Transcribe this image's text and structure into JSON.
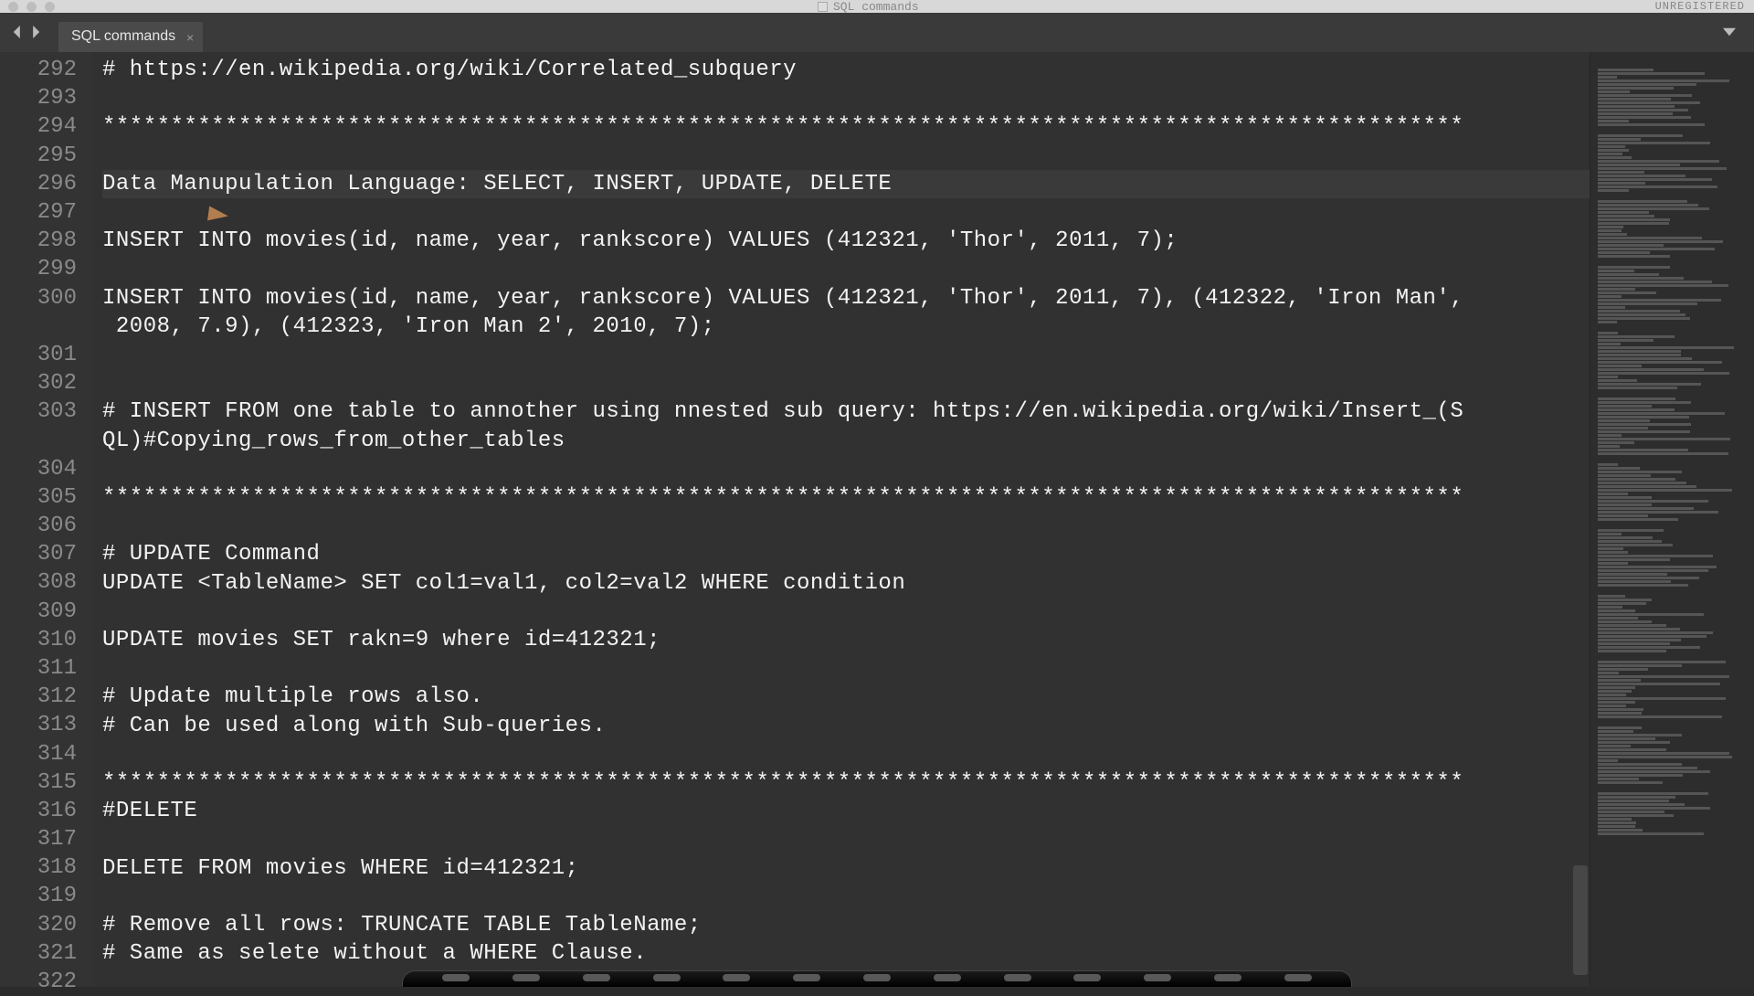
{
  "window": {
    "title_hint": "SQL commands",
    "unregistered_label": "UNREGISTERED"
  },
  "tabs": {
    "active": {
      "label": "SQL commands"
    }
  },
  "editor": {
    "first_line_number": 292,
    "highlighted_line_number": 296,
    "lines": [
      {
        "n": 292,
        "text": "# https://en.wikipedia.org/wiki/Correlated_subquery"
      },
      {
        "n": 293,
        "text": ""
      },
      {
        "n": 294,
        "text": "****************************************************************************************************"
      },
      {
        "n": 295,
        "text": ""
      },
      {
        "n": 296,
        "text": "Data Manupulation Language: SELECT, INSERT, UPDATE, DELETE"
      },
      {
        "n": 297,
        "text": ""
      },
      {
        "n": 298,
        "text": "INSERT INTO movies(id, name, year, rankscore) VALUES (412321, 'Thor', 2011, 7);"
      },
      {
        "n": 299,
        "text": ""
      },
      {
        "n": 300,
        "text": "INSERT INTO movies(id, name, year, rankscore) VALUES (412321, 'Thor', 2011, 7), (412322, 'Iron Man', 2008, 7.9), (412323, 'Iron Man 2', 2010, 7);"
      },
      {
        "n": 301,
        "text": ""
      },
      {
        "n": 302,
        "text": ""
      },
      {
        "n": 303,
        "text": "# INSERT FROM one table to annother using nnested sub query: https://en.wikipedia.org/wiki/Insert_(SQL)#Copying_rows_from_other_tables"
      },
      {
        "n": 304,
        "text": ""
      },
      {
        "n": 305,
        "text": "****************************************************************************************************"
      },
      {
        "n": 306,
        "text": ""
      },
      {
        "n": 307,
        "text": "# UPDATE Command"
      },
      {
        "n": 308,
        "text": "UPDATE <TableName> SET col1=val1, col2=val2 WHERE condition"
      },
      {
        "n": 309,
        "text": ""
      },
      {
        "n": 310,
        "text": "UPDATE movies SET rakn=9 where id=412321;"
      },
      {
        "n": 311,
        "text": ""
      },
      {
        "n": 312,
        "text": "# Update multiple rows also."
      },
      {
        "n": 313,
        "text": "# Can be used along with Sub-queries."
      },
      {
        "n": 314,
        "text": ""
      },
      {
        "n": 315,
        "text": "****************************************************************************************************"
      },
      {
        "n": 316,
        "text": "#DELETE"
      },
      {
        "n": 317,
        "text": ""
      },
      {
        "n": 318,
        "text": "DELETE FROM movies WHERE id=412321;"
      },
      {
        "n": 319,
        "text": ""
      },
      {
        "n": 320,
        "text": "# Remove all rows: TRUNCATE TABLE TableName;"
      },
      {
        "n": 321,
        "text": "# Same as selete without a WHERE Clause."
      },
      {
        "n": 322,
        "text": ""
      }
    ]
  }
}
